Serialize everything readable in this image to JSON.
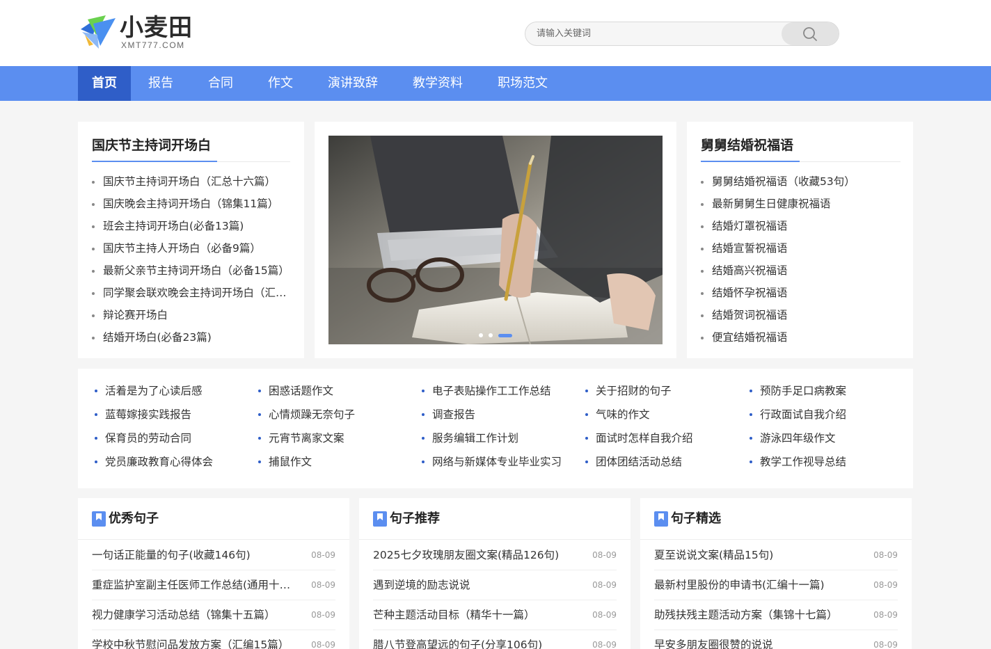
{
  "header": {
    "logo_text": "小麦田",
    "logo_sub": "XMT777.COM",
    "search_placeholder": "请输入关键词"
  },
  "nav": {
    "items": [
      {
        "label": "首页",
        "active": true
      },
      {
        "label": "报告"
      },
      {
        "label": "合同"
      },
      {
        "label": "作文"
      },
      {
        "label": "演讲致辞"
      },
      {
        "label": "教学资料"
      },
      {
        "label": "职场范文"
      }
    ]
  },
  "left_panel": {
    "title": "国庆节主持词开场白",
    "items": [
      "国庆节主持词开场白（汇总十六篇）",
      "国庆晚会主持词开场白（锦集11篇）",
      "班会主持词开场白(必备13篇)",
      "国庆节主持人开场白（必备9篇）",
      "最新父亲节主持词开场白（必备15篇）",
      "同学聚会联欢晚会主持词开场白（汇总）",
      "辩论赛开场白",
      "结婚开场白(必备23篇)"
    ]
  },
  "banner": {
    "slides": 3,
    "active_slide": 3
  },
  "right_panel": {
    "title": "舅舅结婚祝福语",
    "items": [
      "舅舅结婚祝福语（收藏53句）",
      "最新舅舅生日健康祝福语",
      "结婚灯罩祝福语",
      "结婚宣誓祝福语",
      "结婚高兴祝福语",
      "结婚怀孕祝福语",
      "结婚贺词祝福语",
      "便宜结婚祝福语"
    ]
  },
  "links": {
    "columns": [
      [
        "活着是为了心读后感",
        "蓝莓嫁接实践报告",
        "保育员的劳动合同",
        "党员廉政教育心得体会"
      ],
      [
        "困惑话题作文",
        "心情烦躁无奈句子",
        "元宵节离家文案",
        "捕鼠作文"
      ],
      [
        "电子表贴操作工工作总结",
        "调查报告",
        "服务编辑工作计划",
        "网络与新媒体专业毕业实习"
      ],
      [
        "关于招财的句子",
        "气味的作文",
        "面试时怎样自我介绍",
        "团体团结活动总结"
      ],
      [
        "预防手足口病教案",
        "行政面试自我介绍",
        "游泳四年级作文",
        "教学工作视导总结"
      ]
    ]
  },
  "news_cards": [
    {
      "title": "优秀句子",
      "items": [
        {
          "title": "一句话正能量的句子(收藏146句)",
          "date": "08-09"
        },
        {
          "title": "重症监护室副主任医师工作总结(通用十一篇)",
          "date": "08-09"
        },
        {
          "title": "视力健康学习活动总结（锦集十五篇）",
          "date": "08-09"
        },
        {
          "title": "学校中秋节慰问品发放方案（汇编15篇）",
          "date": "08-09"
        }
      ]
    },
    {
      "title": "句子推荐",
      "items": [
        {
          "title": "2025七夕玫瑰朋友圈文案(精品126句)",
          "date": "08-09"
        },
        {
          "title": "遇到逆境的励志说说",
          "date": "08-09"
        },
        {
          "title": "芒种主题活动目标（精华十一篇）",
          "date": "08-09"
        },
        {
          "title": "腊八节登高望远的句子(分享106句)",
          "date": "08-09"
        }
      ]
    },
    {
      "title": "句子精选",
      "items": [
        {
          "title": "夏至说说文案(精品15句)",
          "date": "08-09"
        },
        {
          "title": "最新村里股份的申请书(汇编十一篇)",
          "date": "08-09"
        },
        {
          "title": "助残扶残主题活动方案（集锦十七篇）",
          "date": "08-09"
        },
        {
          "title": "早安多朋友圈很赞的说说",
          "date": "08-09"
        }
      ]
    }
  ],
  "colors": {
    "nav_bg": "#5b8ef0",
    "nav_active": "#2f5ec8",
    "accent": "#5b8ef0"
  }
}
